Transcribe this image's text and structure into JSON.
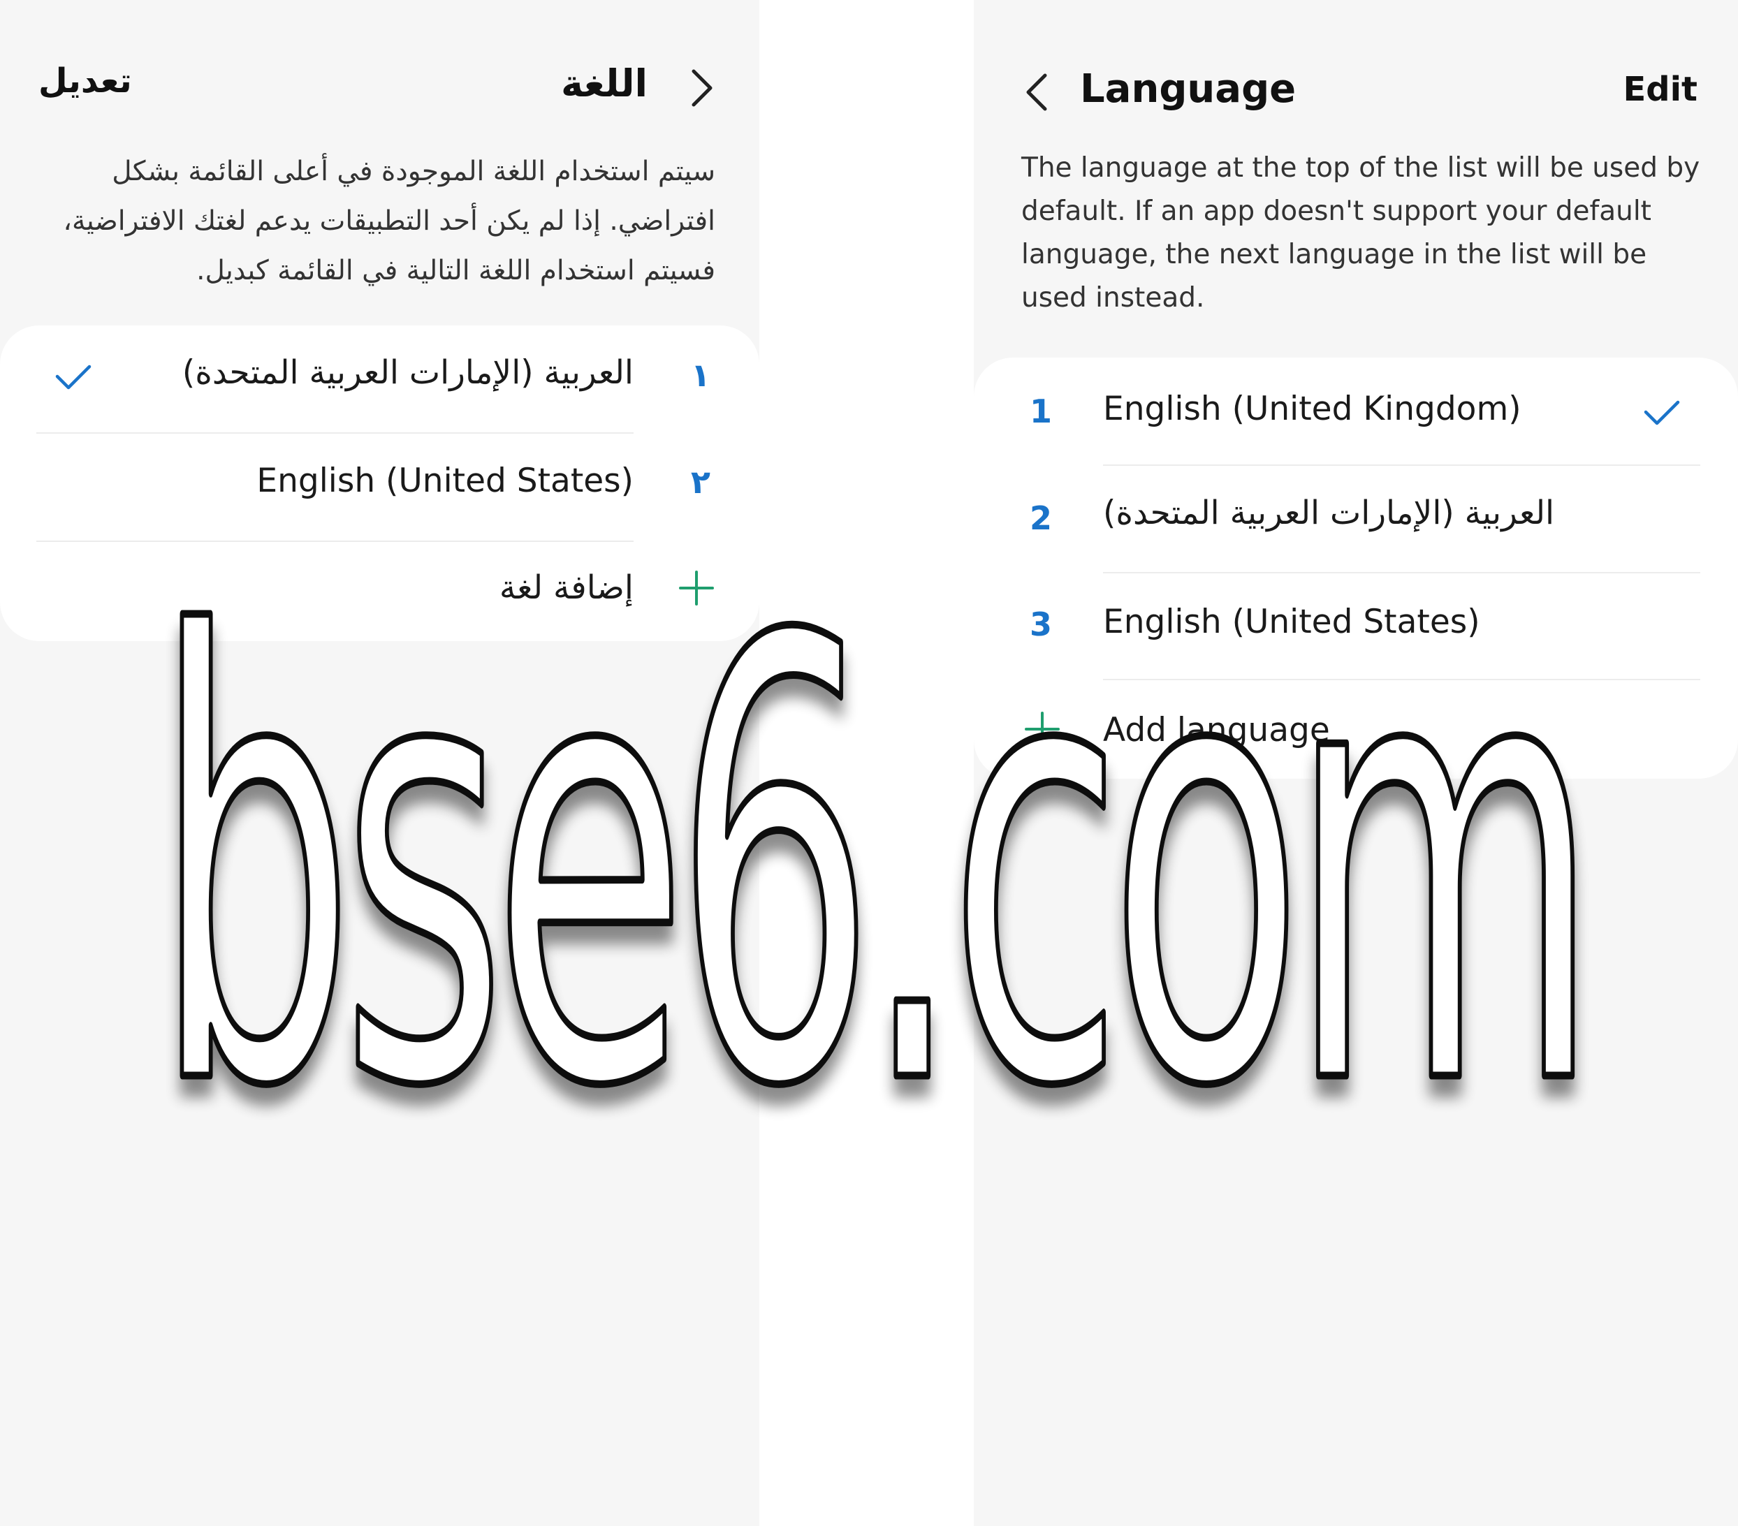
{
  "screen_ar": {
    "title": "اللغة",
    "edit_label": "تعديل",
    "description": "سيتم استخدام اللغة الموجودة في أعلى القائمة بشكل افتراضي. إذا لم يكن أحد التطبيقات يدعم لغتك الافتراضية، فسيتم استخدام اللغة التالية في القائمة كبديل.",
    "languages": [
      {
        "number": "١",
        "name": "العربية (الإمارات العربية المتحدة)",
        "selected": true
      },
      {
        "number": "٢",
        "name": "English (United States)",
        "selected": false
      }
    ],
    "add_language_label": "إضافة لغة"
  },
  "screen_en": {
    "title": "Language",
    "edit_label": "Edit",
    "description": "The language at the top of the list will be used by default. If an app doesn't support your default language, the next language in the list will be used instead.",
    "languages": [
      {
        "number": "1",
        "name": "English (United Kingdom)",
        "selected": true
      },
      {
        "number": "2",
        "name": "العربية (الإمارات العربية المتحدة)",
        "selected": false
      },
      {
        "number": "3",
        "name": "English (United States)",
        "selected": false
      }
    ],
    "add_language_label": "Add language"
  },
  "watermark": "bse6.com",
  "colors": {
    "accent_blue": "#1a73c9",
    "add_green": "#1f9e6e",
    "background": "#f6f6f6",
    "card": "#ffffff"
  },
  "icons": [
    "back-chevron-icon",
    "checkmark-icon",
    "plus-icon"
  ]
}
